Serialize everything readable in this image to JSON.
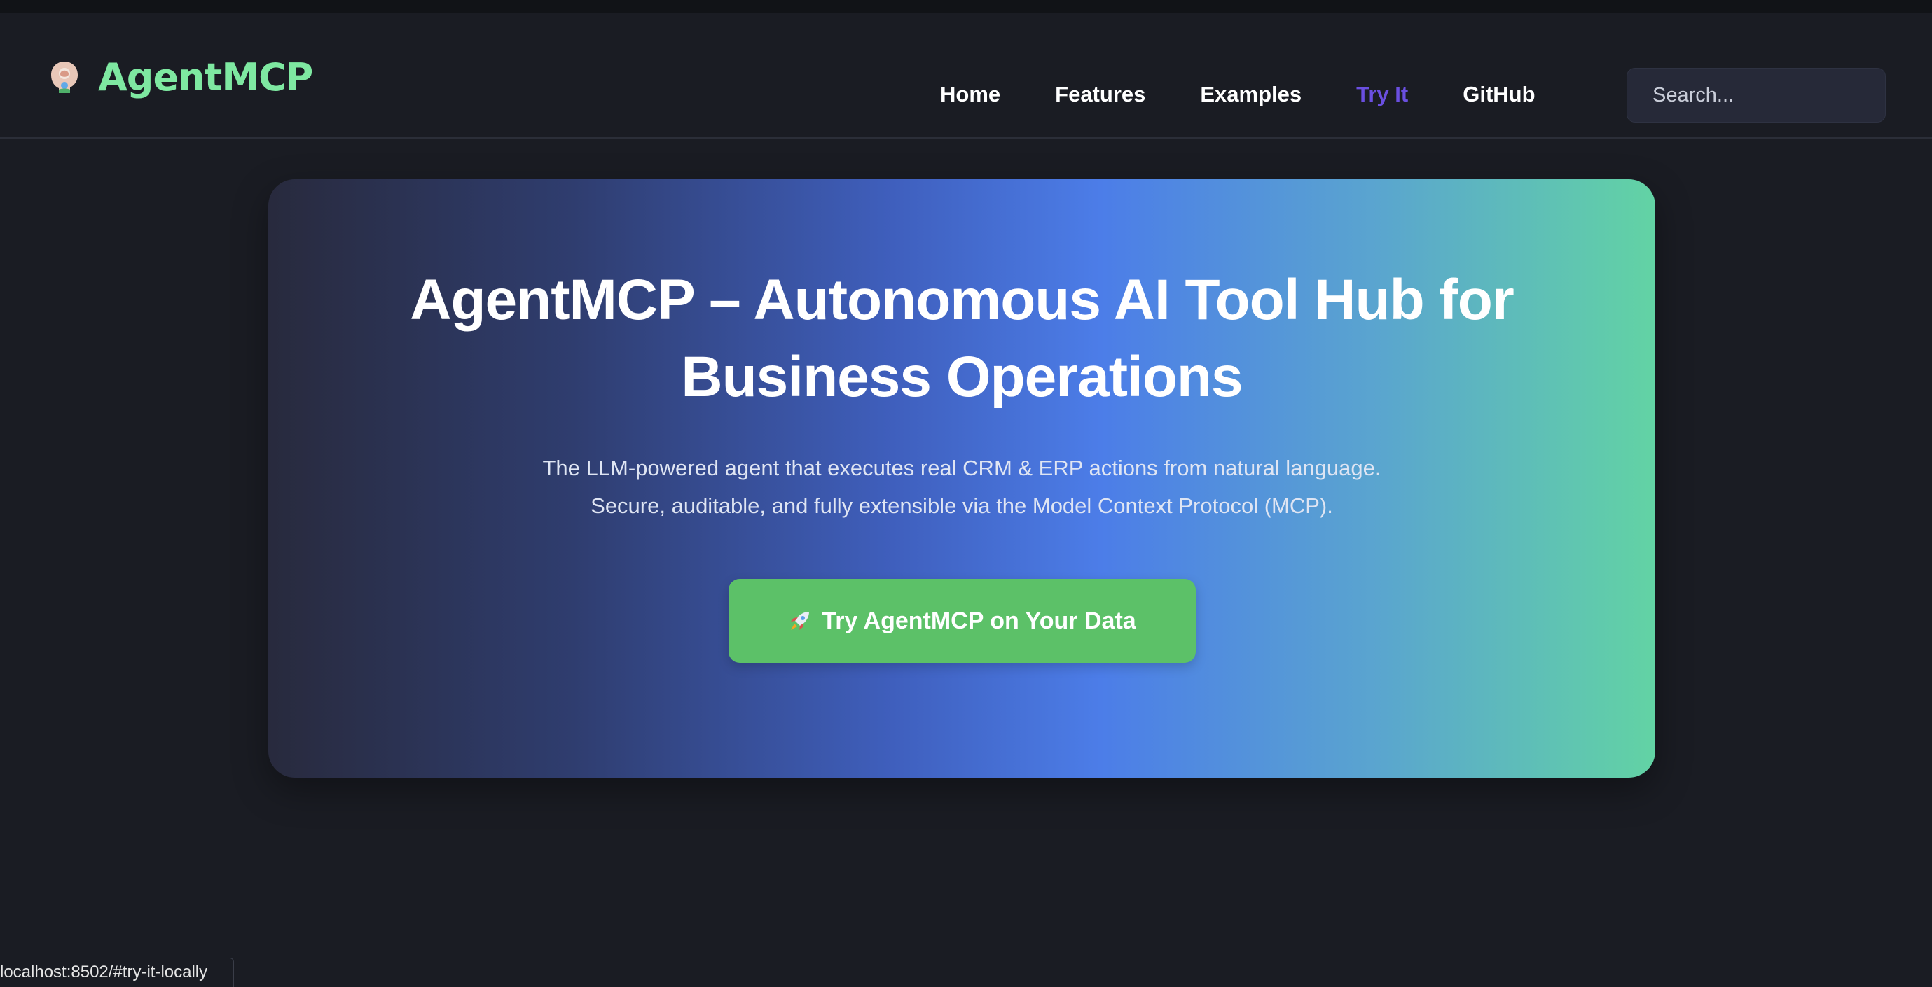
{
  "brand": {
    "name": "AgentMCP",
    "icon": "brain-head-icon"
  },
  "nav": {
    "items": [
      {
        "label": "Home",
        "active": false
      },
      {
        "label": "Features",
        "active": false
      },
      {
        "label": "Examples",
        "active": false
      },
      {
        "label": "Try It",
        "active": true
      },
      {
        "label": "GitHub",
        "active": false
      }
    ]
  },
  "search": {
    "placeholder": "Search...",
    "value": ""
  },
  "hero": {
    "title": "AgentMCP – Autonomous AI Tool Hub for Business Operations",
    "subtitle_line1": "The LLM-powered agent that executes real CRM & ERP actions from natural language.",
    "subtitle_line2": "Secure, auditable, and fully extensible via the Model Context Protocol (MCP).",
    "cta_label": "Try AgentMCP on Your Data",
    "cta_icon": "rocket-icon"
  },
  "status_bar": {
    "url": "localhost:8502/#try-it-locally"
  },
  "colors": {
    "brand": "#7ee8a1",
    "nav_active": "#6a4fe0",
    "cta": "#5cc168",
    "background": "#1a1c23"
  }
}
